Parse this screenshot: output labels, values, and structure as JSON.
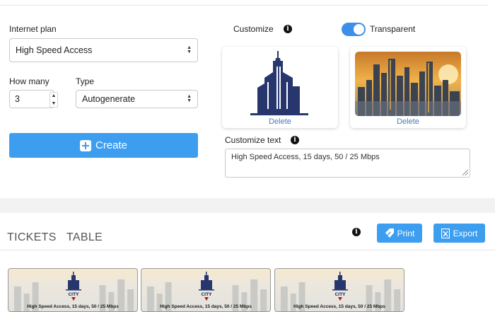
{
  "form": {
    "internet_plan_label": "Internet plan",
    "internet_plan_value": "High Speed Access",
    "how_many_label": "How many",
    "how_many_value": "3",
    "type_label": "Type",
    "type_value": "Autogenerate",
    "create_label": "Create"
  },
  "customize": {
    "label": "Customize",
    "transparent_label": "Transparent",
    "transparent_on": true,
    "delete_logo_label": "Delete",
    "delete_background_label": "Delete",
    "text_label": "Customize text",
    "text_value": "High Speed Access, 15 days, 50 / 25 Mbps"
  },
  "tickets_section": {
    "tabs": [
      "TICKETS",
      "TABLE"
    ],
    "print_label": "Print",
    "export_label": "Export",
    "tickets": [
      {
        "text": "High Speed Access, 15 days, 50 / 25 Mbps",
        "logo_text": "CITY"
      },
      {
        "text": "High Speed Access, 15 days, 50 / 25 Mbps",
        "logo_text": "CITY"
      },
      {
        "text": "High Speed Access, 15 days, 50 / 25 Mbps",
        "logo_text": "CITY"
      }
    ]
  },
  "colors": {
    "accent": "#3d9ef0",
    "logo_navy": "#27376e",
    "link": "#3d7fc4"
  },
  "icons": [
    "info-icon",
    "plus-icon",
    "tag-icon",
    "export-icon",
    "chevron-up-down-icon"
  ]
}
